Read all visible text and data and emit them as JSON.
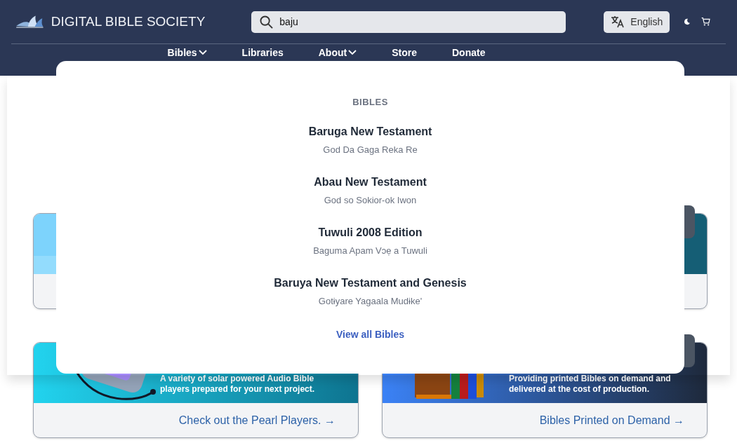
{
  "header": {
    "logo_text": "DIGITAL BIBLE SOCIETY",
    "search": {
      "value": "baju"
    },
    "language_button": "English"
  },
  "nav": [
    {
      "label": "Bibles",
      "has_menu": true
    },
    {
      "label": "Libraries",
      "has_menu": false
    },
    {
      "label": "About",
      "has_menu": true
    },
    {
      "label": "Store",
      "has_menu": false
    },
    {
      "label": "Donate",
      "has_menu": false
    }
  ],
  "search_results": {
    "heading": "BIBLES",
    "items": [
      {
        "title": "Baruga New Testament",
        "subtitle": "God Da Gaga Reka Re"
      },
      {
        "title": "Abau New Testament",
        "subtitle": "God so Sokior-ok Iwon"
      },
      {
        "title": "Tuwuli 2008 Edition",
        "subtitle": "Baguma Apam Vɔẹ a Tuwuli"
      },
      {
        "title": "Baruya New Testament and Genesis",
        "subtitle": "Gotɨyare Yagaala Mudɨke'"
      }
    ],
    "view_all": "View all Bibles"
  },
  "cards": [
    {
      "kind": "sky",
      "corner_button": false
    },
    {
      "kind": "teal",
      "corner_button": true
    },
    {
      "kind": "audio-player",
      "corner_button": false,
      "caption": "A variety of solar powered Audio Bible players prepared for your next project.",
      "link": "Check out the Pearl Players. →"
    },
    {
      "kind": "books",
      "corner_button": true,
      "caption": "Providing printed Bibles on demand and delivered at the cost of production.",
      "link": "Bibles Printed on Demand →"
    }
  ]
}
